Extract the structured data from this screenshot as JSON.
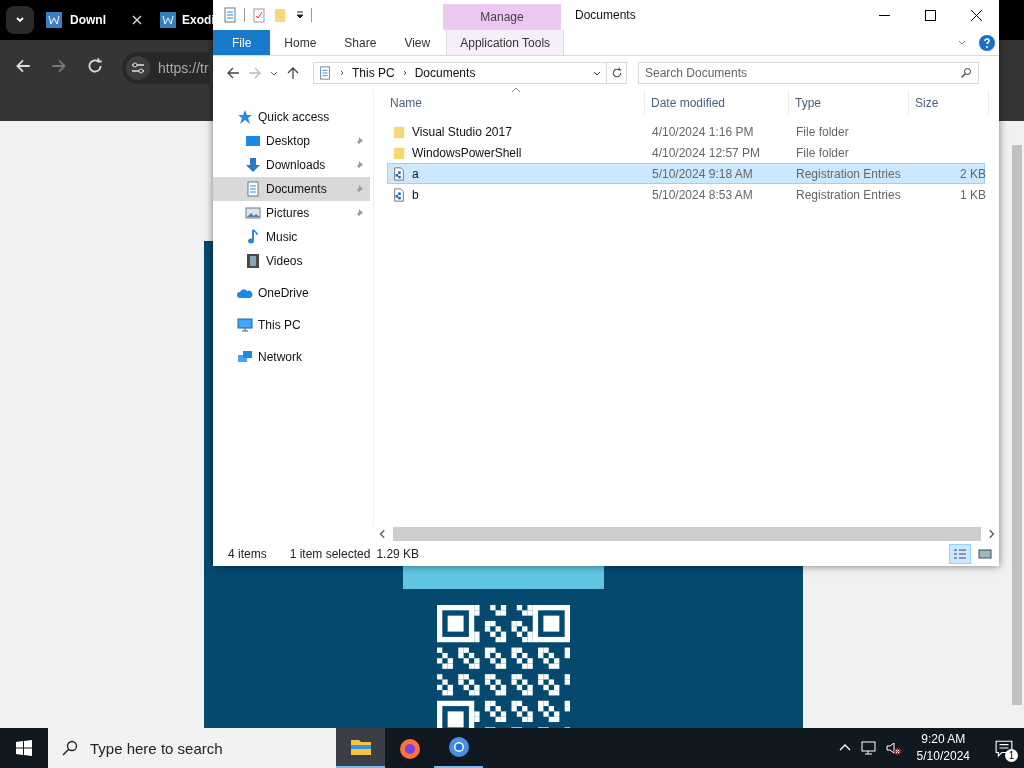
{
  "browser": {
    "tabs": [
      {
        "title": "Downl",
        "close_button": true
      },
      {
        "title": "Exodi",
        "close_button": false
      }
    ],
    "url": "https://tr"
  },
  "explorer": {
    "title": "Documents",
    "contextual_group": "Manage",
    "ribbon_tabs": [
      {
        "label": "File",
        "kind": "file"
      },
      {
        "label": "Home",
        "kind": "plain"
      },
      {
        "label": "Share",
        "kind": "plain"
      },
      {
        "label": "View",
        "kind": "plain"
      },
      {
        "label": "Application Tools",
        "kind": "contextual"
      }
    ],
    "path": [
      "This PC",
      "Documents"
    ],
    "search": {
      "placeholder": "Search Documents"
    },
    "nav": [
      {
        "label": "Quick access",
        "kind": "star",
        "selected": false,
        "children": [
          {
            "label": "Desktop",
            "kind": "desktop",
            "pinned": true,
            "selected": false
          },
          {
            "label": "Downloads",
            "kind": "download",
            "pinned": true,
            "selected": false
          },
          {
            "label": "Documents",
            "kind": "document",
            "pinned": true,
            "selected": true
          },
          {
            "label": "Pictures",
            "kind": "picture",
            "pinned": true,
            "selected": false
          },
          {
            "label": "Music",
            "kind": "music",
            "pinned": false,
            "selected": false
          },
          {
            "label": "Videos",
            "kind": "video",
            "pinned": false,
            "selected": false
          }
        ]
      },
      {
        "label": "OneDrive",
        "kind": "cloud",
        "selected": false
      },
      {
        "label": "This PC",
        "kind": "computer",
        "selected": false
      },
      {
        "label": "Network",
        "kind": "network",
        "selected": false
      }
    ],
    "columns": [
      {
        "label": "Name",
        "sorted": true
      },
      {
        "label": "Date modified",
        "sorted": false
      },
      {
        "label": "Type",
        "sorted": false
      },
      {
        "label": "Size",
        "sorted": false
      }
    ],
    "rows": [
      {
        "name": "Visual Studio 2017",
        "date": "4/10/2024 1:16 PM",
        "type": "File folder",
        "size": "",
        "kind": "folder",
        "selected": false
      },
      {
        "name": "WindowsPowerShell",
        "date": "4/10/2024 12:57 PM",
        "type": "File folder",
        "size": "",
        "kind": "folder",
        "selected": false
      },
      {
        "name": "a",
        "date": "5/10/2024 9:18 AM",
        "type": "Registration Entries",
        "size": "2 KB",
        "kind": "registry",
        "selected": true
      },
      {
        "name": "b",
        "date": "5/10/2024 8:53 AM",
        "type": "Registration Entries",
        "size": "1 KB",
        "kind": "registry",
        "selected": false
      }
    ],
    "status": {
      "count": "4 items",
      "selection": "1 item selected",
      "size": "1.29 KB"
    },
    "views": [
      {
        "kind": "details",
        "selected": true
      },
      {
        "kind": "thumbnails",
        "selected": false
      }
    ]
  },
  "taskbar": {
    "search": {
      "placeholder": "Type here to search"
    },
    "apps": [
      {
        "kind": "folder",
        "selected": true,
        "running": true
      },
      {
        "kind": "firefox",
        "selected": false,
        "running": false
      },
      {
        "kind": "chrome",
        "selected": false,
        "running": true
      }
    ],
    "volume_muted": true,
    "time": "9:20 AM",
    "date": "5/10/2024",
    "notifications": "1"
  }
}
